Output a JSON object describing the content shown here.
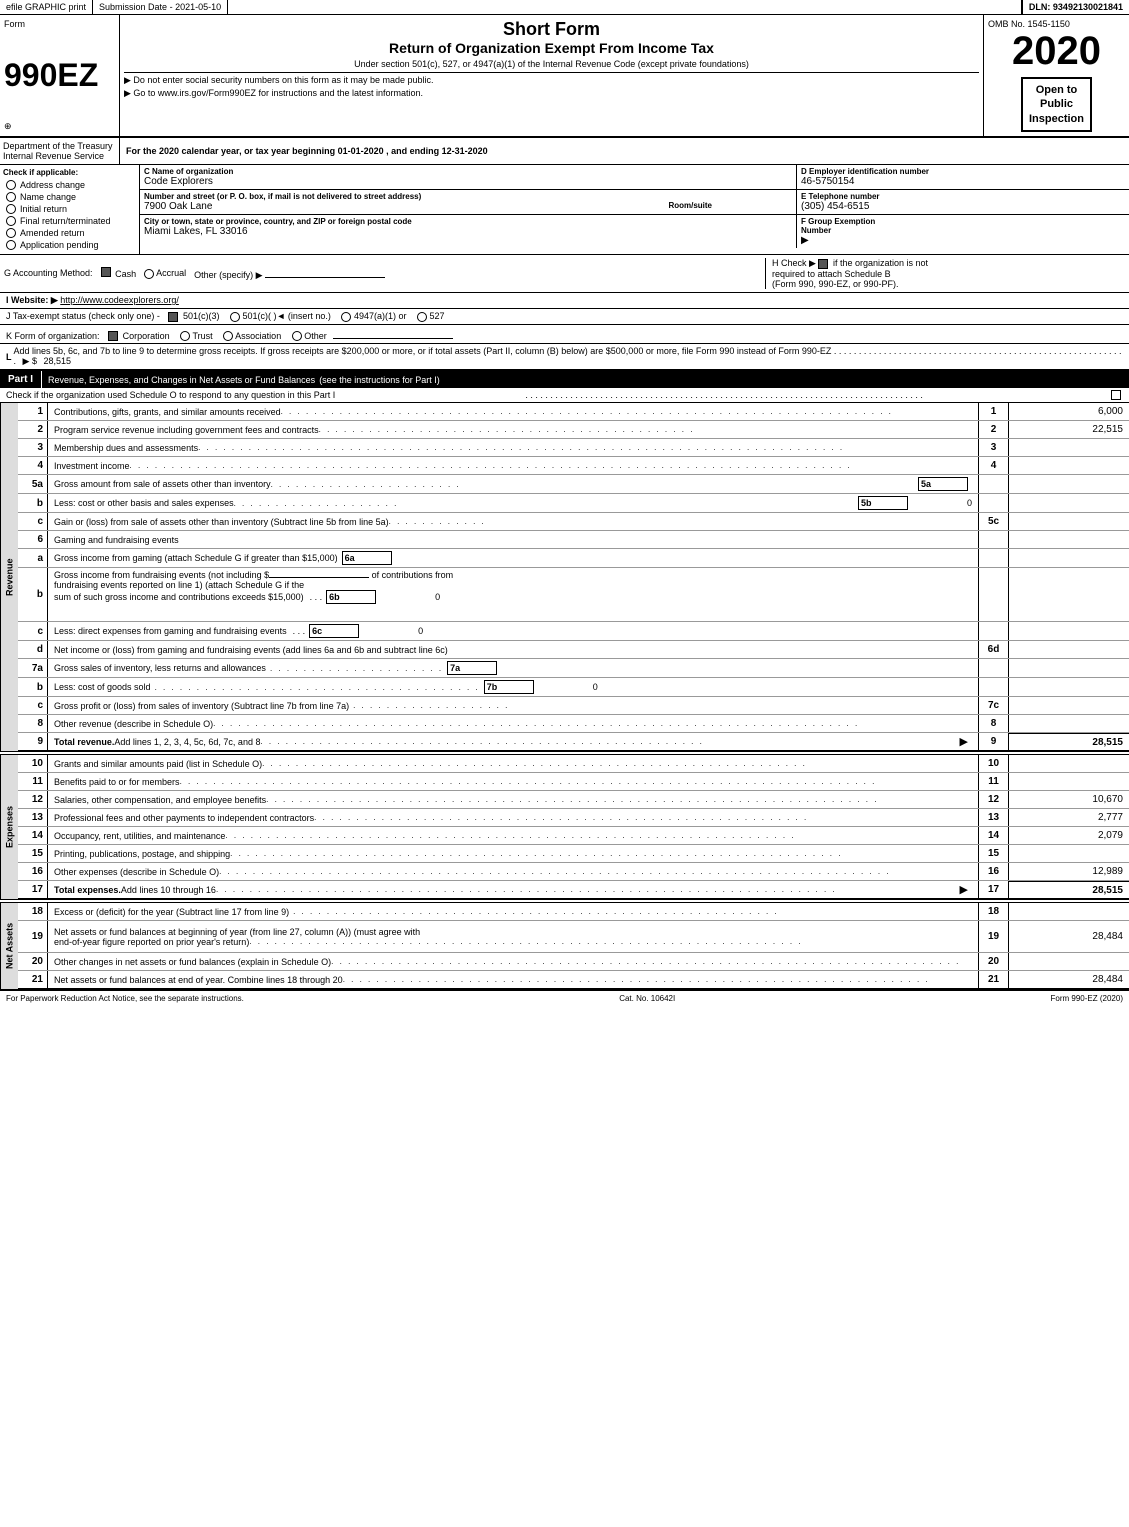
{
  "topBar": {
    "efile": "efile GRAPHIC print",
    "submissionLabel": "Submission Date -",
    "submissionDate": "2021-05-10",
    "dlnLabel": "DLN:",
    "dlnNumber": "93492130021841"
  },
  "header": {
    "formNumber": "990EZ",
    "formLabel": "Form",
    "formSub": "⊕",
    "shortForm": "Short Form",
    "returnTitle": "Return of Organization Exempt From Income Tax",
    "underSection": "Under section 501(c), 527, or 4947(a)(1) of the Internal Revenue Code (except private foundations)",
    "noSSN": "▶ Do not enter social security numbers on this form as it may be made public.",
    "goTo": "▶ Go to www.irs.gov/Form990EZ for instructions and the latest information.",
    "ombLabel": "OMB No. 1545-1150",
    "year": "2020",
    "openBadge": "Open to\nPublic\nInspection"
  },
  "deptRow": {
    "dept": "Department of the\nTreasury",
    "irsLabel": "Internal Revenue\nService",
    "calendarYear": "For the 2020 calendar year, or tax year beginning 01-01-2020 , and ending 12-31-2020"
  },
  "checkApplicable": {
    "label": "Check if applicable:",
    "items": [
      {
        "id": "address",
        "text": "Address change",
        "checked": false
      },
      {
        "id": "name",
        "text": "Name change",
        "checked": false
      },
      {
        "id": "initial",
        "text": "Initial return",
        "checked": false
      },
      {
        "id": "final",
        "text": "Final return/terminated",
        "checked": false
      },
      {
        "id": "amended",
        "text": "Amended return",
        "checked": false
      },
      {
        "id": "pending",
        "text": "Application pending",
        "checked": false
      }
    ]
  },
  "orgInfo": {
    "nameLabel": "C Name of organization",
    "orgName": "Code Explorers",
    "employerLabel": "D Employer identification number",
    "ein": "46-5750154",
    "streetLabel": "Number and street (or P. O. box, if mail is not delivered to street address)",
    "street": "7900 Oak Lane",
    "roomSuiteLabel": "Room/suite",
    "roomSuite": "",
    "phoneLabel": "E Telephone number",
    "phone": "(305) 454-6515",
    "cityLabel": "City or town, state or province, country, and ZIP or foreign postal code",
    "city": "Miami Lakes, FL  33016",
    "groupExemptLabel": "F Group Exemption\nNumber",
    "groupExempt": "▶"
  },
  "accounting": {
    "label": "G Accounting Method:",
    "cash": "Cash",
    "cashChecked": true,
    "accrual": "Accrual",
    "accrualChecked": false,
    "other": "Other (specify) ▶",
    "hCheck": "H  Check ▶",
    "hCheckChecked": true,
    "hText": "if the organization is not\nrequired to attach Schedule B\n(Form 990, 990-EZ, or 990-PF)."
  },
  "website": {
    "label": "I Website: ▶",
    "url": "http://www.codeexplorers.org/"
  },
  "taxStatus": {
    "label": "J Tax-exempt status (check only one) -",
    "options": [
      {
        "id": "501c3",
        "text": "501(c)(3)",
        "checked": true
      },
      {
        "id": "501c",
        "text": "501(c)(  )◄ (insert no.)",
        "checked": false
      },
      {
        "id": "4947",
        "text": "4947(a)(1) or",
        "checked": false
      },
      {
        "id": "527",
        "text": "527",
        "checked": false
      }
    ]
  },
  "formOrg": {
    "label": "K Form of organization:",
    "options": [
      {
        "id": "corp",
        "text": "Corporation",
        "checked": true
      },
      {
        "id": "trust",
        "text": "Trust",
        "checked": false
      },
      {
        "id": "assoc",
        "text": "Association",
        "checked": false
      },
      {
        "id": "other",
        "text": "Other",
        "checked": false
      }
    ]
  },
  "lineL": {
    "text": "L Add lines 5b, 6c, and 7b to line 9 to determine gross receipts. If gross receipts are $200,000 or more, or if total assets (Part II, column (B) below) are $500,000 or more, file Form 990 instead of Form 990-EZ",
    "dots": ". . . . . . . . . . . . . . . . . . . . . . . . . . . . . . . . . . . . . . . . . . . . . . . .",
    "arrow": "▶ $",
    "value": "28,515"
  },
  "partI": {
    "title": "Revenue, Expenses, and Changes in Net Assets or Fund Balances",
    "titleSub": "(see the instructions for Part I)",
    "scheduleOCheck": "Check if the organization used Schedule O to respond to any question in this Part I",
    "rows": [
      {
        "num": "1",
        "desc": "Contributions, gifts, grants, and similar amounts received",
        "lineNum": "1",
        "value": "6,000"
      },
      {
        "num": "2",
        "desc": "Program service revenue including government fees and contracts",
        "lineNum": "2",
        "value": "22,515"
      },
      {
        "num": "3",
        "desc": "Membership dues and assessments",
        "lineNum": "3",
        "value": ""
      },
      {
        "num": "4",
        "desc": "Investment income",
        "lineNum": "4",
        "value": ""
      },
      {
        "num": "5a",
        "desc": "Gross amount from sale of assets other than inventory",
        "lineNum": "5a",
        "value": ""
      },
      {
        "num": "b",
        "desc": "Less: cost or other basis and sales expenses",
        "lineNum": "5b",
        "value": "0"
      },
      {
        "num": "c",
        "desc": "Gain or (loss) from sale of assets other than inventory (Subtract line 5b from line 5a)",
        "lineNum": "5c",
        "value": ""
      },
      {
        "num": "6",
        "desc": "Gaming and fundraising events",
        "lineNum": "",
        "value": ""
      },
      {
        "num": "a",
        "desc": "Gross income from gaming (attach Schedule G if greater than $15,000)",
        "lineNum": "6a",
        "value": ""
      },
      {
        "num": "b",
        "desc": "Gross income from fundraising events (not including $                of contributions from fundraising events reported on line 1) (attach Schedule G if the sum of such gross income and contributions exceeds $15,000)",
        "lineNum": "6b",
        "value": "0"
      },
      {
        "num": "c",
        "desc": "Less: direct expenses from gaming and fundraising events",
        "lineNum": "6c",
        "value": "0"
      },
      {
        "num": "d",
        "desc": "Net income or (loss) from gaming and fundraising events (add lines 6a and 6b and subtract line 6c)",
        "lineNum": "6d",
        "value": ""
      },
      {
        "num": "7a",
        "desc": "Gross sales of inventory, less returns and allowances",
        "lineNum": "7a",
        "value": ""
      },
      {
        "num": "b",
        "desc": "Less: cost of goods sold",
        "lineNum": "7b",
        "value": "0"
      },
      {
        "num": "c",
        "desc": "Gross profit or (loss) from sales of inventory (Subtract line 7b from line 7a)",
        "lineNum": "7c",
        "value": ""
      },
      {
        "num": "8",
        "desc": "Other revenue (describe in Schedule O)",
        "lineNum": "8",
        "value": ""
      },
      {
        "num": "9",
        "desc": "Total revenue. Add lines 1, 2, 3, 4, 5c, 6d, 7c, and 8",
        "lineNum": "9",
        "value": "28,515",
        "bold": true,
        "arrow": "▶"
      }
    ]
  },
  "expenses": {
    "rows": [
      {
        "num": "10",
        "desc": "Grants and similar amounts paid (list in Schedule O)",
        "lineNum": "10",
        "value": ""
      },
      {
        "num": "11",
        "desc": "Benefits paid to or for members",
        "lineNum": "11",
        "value": ""
      },
      {
        "num": "12",
        "desc": "Salaries, other compensation, and employee benefits",
        "lineNum": "12",
        "value": "10,670"
      },
      {
        "num": "13",
        "desc": "Professional fees and other payments to independent contractors",
        "lineNum": "13",
        "value": "2,777"
      },
      {
        "num": "14",
        "desc": "Occupancy, rent, utilities, and maintenance",
        "lineNum": "14",
        "value": "2,079"
      },
      {
        "num": "15",
        "desc": "Printing, publications, postage, and shipping",
        "lineNum": "15",
        "value": ""
      },
      {
        "num": "16",
        "desc": "Other expenses (describe in Schedule O)",
        "lineNum": "16",
        "value": "12,989"
      },
      {
        "num": "17",
        "desc": "Total expenses. Add lines 10 through 16",
        "lineNum": "17",
        "value": "28,515",
        "bold": true,
        "arrow": "▶"
      }
    ]
  },
  "netAssets": {
    "rows": [
      {
        "num": "18",
        "desc": "Excess or (deficit) for the year (Subtract line 17 from line 9)",
        "lineNum": "18",
        "value": ""
      },
      {
        "num": "19",
        "desc": "Net assets or fund balances at beginning of year (from line 27, column (A)) (must agree with end-of-year figure reported on prior year's return)",
        "lineNum": "19",
        "value": "28,484"
      },
      {
        "num": "20",
        "desc": "Other changes in net assets or fund balances (explain in Schedule O)",
        "lineNum": "20",
        "value": ""
      },
      {
        "num": "21",
        "desc": "Net assets or fund balances at end of year. Combine lines 18 through 20",
        "lineNum": "21",
        "value": "28,484"
      }
    ]
  },
  "footer": {
    "paperwork": "For Paperwork Reduction Act Notice, see the separate instructions.",
    "catNo": "Cat. No. 10642I",
    "formRef": "Form 990-EZ (2020)"
  },
  "sideLabels": {
    "revenue": "Revenue",
    "expenses": "Expenses",
    "netAssets": "Net Assets"
  }
}
